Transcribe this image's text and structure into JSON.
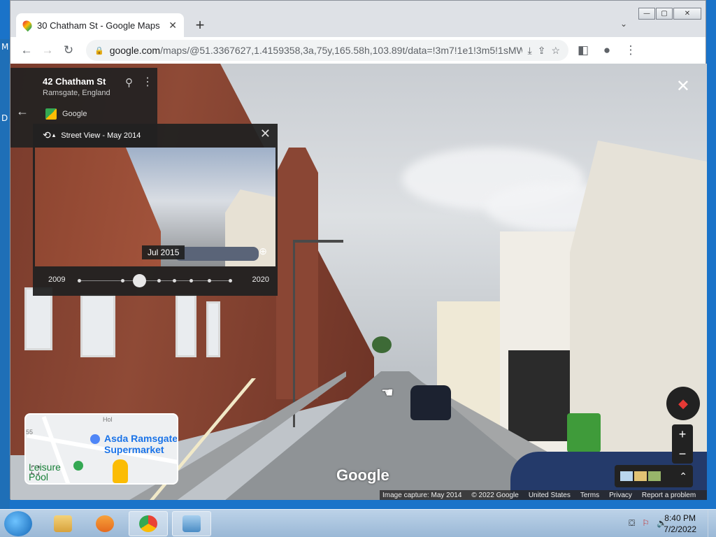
{
  "desktop": {
    "letters": [
      "M",
      "D"
    ]
  },
  "browser": {
    "tab_title": "30 Chatham St - Google Maps",
    "tab_close": "✕",
    "new_tab": "+",
    "tab_menu": "⌄",
    "win_min": "—",
    "win_max": "▢",
    "win_close": "✕",
    "back": "←",
    "forward": "→",
    "reload": "↻",
    "url_host": "google.com",
    "url_path": "/maps/@51.3367627,1.4159358,3a,75y,165.58h,103.89t/data=!3m7!1e1!3m5!1sMWapFVGx...",
    "lock": "🔒",
    "install": "⤓",
    "share": "⇪",
    "star": "☆",
    "sidepanel": "◧",
    "profile": "●",
    "menu": "⋮"
  },
  "streetview": {
    "close": "✕",
    "cursor": "☚",
    "watermark": "Google",
    "info": {
      "back": "←",
      "title": "42 Chatham St",
      "subtitle": "Ramsgate, England",
      "pin": "⚲",
      "more": "⋮",
      "source": "Google"
    },
    "timemachine": {
      "history_icon": "⟲",
      "caret": "▴",
      "title": "Street View - May 2014",
      "close": "✕",
      "tooltip": "Jul 2015",
      "zoom": "⊕",
      "year_start": "2009",
      "year_end": "2020",
      "slider_value": 0.4
    },
    "minimap": {
      "store": "Asda Ramsgate\nSupermarket",
      "park": "Leisure\nPool",
      "road1": "Hol",
      "road2": "55",
      "expand": "⛶"
    },
    "compass": "◆",
    "zoom_in": "+",
    "zoom_out": "−",
    "layers_expand": "⌃",
    "footer": [
      "Image capture: May 2014",
      "© 2022 Google",
      "United States",
      "Terms",
      "Privacy",
      "Report a problem"
    ]
  },
  "taskbar": {
    "time": "8:40 PM",
    "date": "7/2/2022",
    "tray": [
      "⛋",
      "⚐",
      "🔊"
    ]
  },
  "colors": {
    "maps_blue": "#1a73e8",
    "park_green": "#188038",
    "dark_panel": "#222222"
  }
}
